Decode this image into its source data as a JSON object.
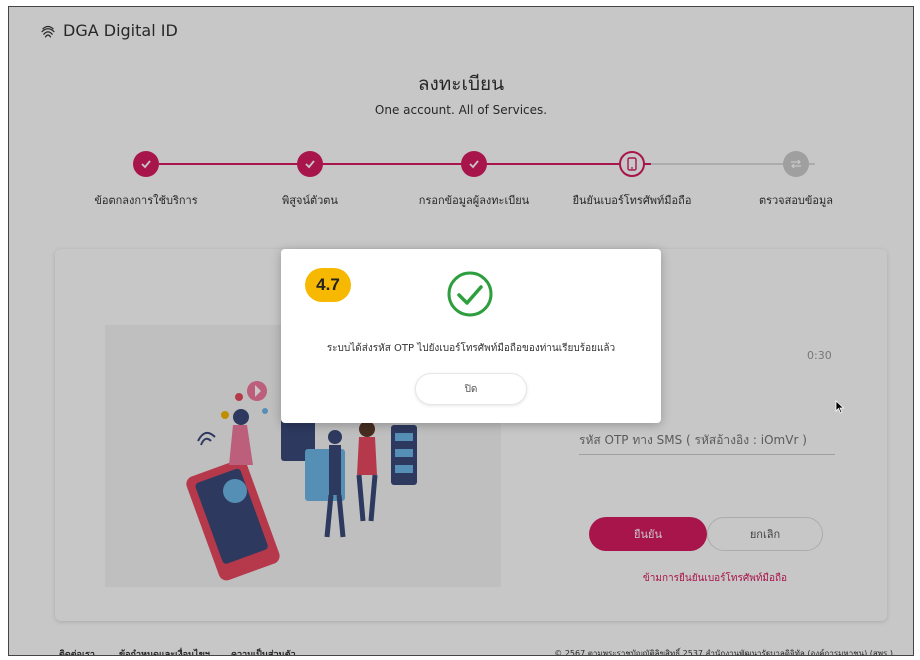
{
  "app": {
    "brand": "DGA Digital ID"
  },
  "page": {
    "title": "ลงทะเบียน",
    "subtitle": "One account. All of Services."
  },
  "steps": [
    {
      "label": "ข้อตกลงการใช้บริการ",
      "state": "done"
    },
    {
      "label": "พิสูจน์ตัวตน",
      "state": "done"
    },
    {
      "label": "กรอกข้อมูลผู้ลงทะเบียน",
      "state": "done"
    },
    {
      "label": "ยืนยันเบอร์โทรศัพท์มือถือ",
      "state": "current"
    },
    {
      "label": "ตรวจสอบข้อมูล",
      "state": "todo"
    }
  ],
  "form": {
    "timer": "0:30",
    "otp_placeholder": "รหัส OTP ทาง SMS ( รหัสอ้างอิง : iOmVr )",
    "confirm_label": "ยืนยัน",
    "cancel_label": "ยกเลิก",
    "skip_link": "ข้ามการยืนยันเบอร์โทรศัพท์มือถือ"
  },
  "footer": {
    "contact": "ติดต่อเรา",
    "terms": "ข้อกำหนดและเงื่อนไขฯ",
    "privacy": "ความเป็นส่วนตัว",
    "copyright": "© 2567 ตามพระราชบัญญัติลิขสิทธิ์ 2537 สำนักงานพัฒนารัฐบาลดิจิทัล (องค์การมหาชน) (สพร.)"
  },
  "modal": {
    "message": "ระบบได้ส่งรหัส OTP ไปยังเบอร์โทรศัพท์มือถือของท่านเรียบร้อยแล้ว",
    "close_label": "ปิด"
  },
  "badge": {
    "text": "4.7"
  },
  "colors": {
    "accent": "#d81b60",
    "success": "#2e9e3e",
    "badge": "#f6b800"
  }
}
